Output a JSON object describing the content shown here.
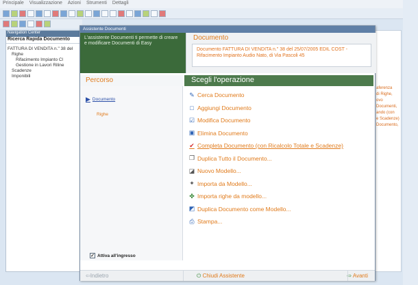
{
  "app": {
    "menu": [
      "Principale",
      "Visualizzazione",
      "Azioni",
      "Strumenti",
      "Dettagli"
    ],
    "search_panel_header": "Navigation Center",
    "search_panel_title": "Ricerca Rapida Documento",
    "tree": [
      "FATTURA DI VENDITA n.\" 38 del",
      "Righe",
      "Rifacimento Impianto Cl",
      "Gestione in Lavori Riline",
      "Scadenze",
      "Imponibili"
    ],
    "right_panel_text": [
      "aferenza",
      "di Righe,",
      "ovo Documenti,",
      "ando (con",
      "e Scadenze)",
      "Documento,"
    ]
  },
  "wizard": {
    "title": "Assistente Documenti",
    "intro": "L'assistente Documenti ti permette di creare e modificare Documenti di Easy",
    "doc_header_title": "Documento",
    "doc_header_text": "Documento FATTURA DI VENDITA n.\" 38 del 25/07/2005 EDIL COST - Rifacimento Impianto Audio Nato, di Via Pascoli 45",
    "percorso_title": "Percorso",
    "steps": [
      "Documento",
      "Righe"
    ],
    "operations_title": "Scegli l'operazione",
    "operations": [
      {
        "label": "Cerca Documento",
        "icon": "pencil-search-icon"
      },
      {
        "label": "Aggiungi Documento",
        "icon": "new-document-icon"
      },
      {
        "label": "Modifica Documento",
        "icon": "edit-document-icon"
      },
      {
        "label": "Elimina Documento",
        "icon": "delete-document-icon"
      },
      {
        "label": "Completa Documento (con Ricalcolo Totale e Scadenze)",
        "icon": "checkmark-icon"
      },
      {
        "label": "Duplica Tutto il Documento...",
        "icon": "duplicate-icon"
      },
      {
        "label": "Nuovo Modello...",
        "icon": "new-model-icon"
      },
      {
        "label": "Importa da Modello...",
        "icon": "import-model-icon"
      },
      {
        "label": "Importa righe da modello...",
        "icon": "import-rows-icon"
      },
      {
        "label": "Duplica Documento come Modello...",
        "icon": "duplicate-model-icon"
      },
      {
        "label": "Stampa...",
        "icon": "print-icon"
      }
    ],
    "attiva_label": "Attiva all'ingresso",
    "attiva_checked": true,
    "back_label": "Indietro",
    "close_label": "Chiudi Assistente",
    "next_label": "Avanti"
  },
  "colors": {
    "accent_orange": "#e07a1a",
    "header_green": "#4d7a4c",
    "intro_green": "#3b6a3a",
    "link_blue": "#2b4fa8"
  }
}
